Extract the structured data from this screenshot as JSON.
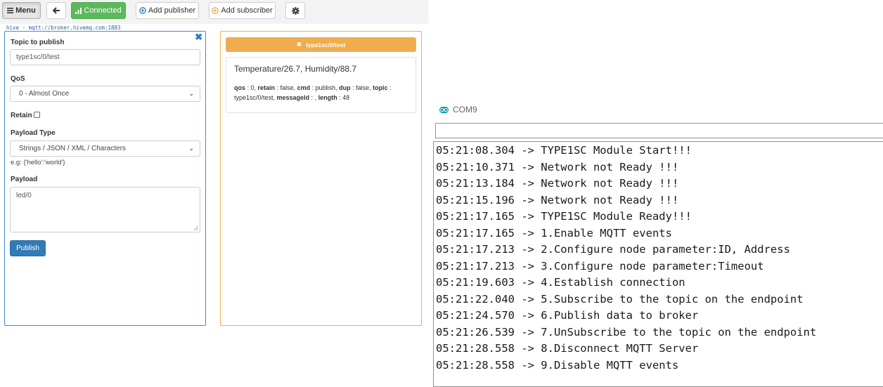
{
  "toolbar": {
    "menu_label": "Menu",
    "connected_label": "Connected",
    "add_publisher_label": "Add publisher",
    "add_subscriber_label": "Add subscriber"
  },
  "broker": {
    "label": "hive - mqtt://broker.hivemq.com:1883"
  },
  "publisher": {
    "topic_label": "Topic to publish",
    "topic_value": "type1sc/0/test",
    "qos_label": "QoS",
    "qos_value": "0 - Almost Once",
    "retain_label": "Retain",
    "retain_checked": false,
    "payload_type_label": "Payload Type",
    "payload_type_value": "Strings / JSON / XML / Characters",
    "payload_hint": "e.g: {'hello':'world'}",
    "payload_label": "Payload",
    "payload_value": "led/0",
    "publish_label": "Publish"
  },
  "subscriber": {
    "topic": "type1sc/0/test",
    "message": {
      "payload": "Temperature/26.7, Humidity/88.7",
      "qos_key": "qos",
      "qos_val": " : 0, ",
      "retain_key": "retain",
      "retain_val": " : false, ",
      "cmd_key": "cmd",
      "cmd_val": " : publish, ",
      "dup_key": "dup",
      "dup_val": " : false, ",
      "topic_key": "topic",
      "topic_val": " : type1sc/0/test, ",
      "messageid_key": "messageId",
      "messageid_val": " : , ",
      "length_key": "length",
      "length_val": " : 48"
    }
  },
  "serial_monitor": {
    "title": "COM9",
    "input_value": "",
    "lines": [
      "05:21:08.304 -> TYPE1SC Module Start!!!",
      "05:21:10.371 -> Network not Ready !!!",
      "05:21:13.184 -> Network not Ready !!!",
      "05:21:15.196 -> Network not Ready !!!",
      "05:21:17.165 -> TYPE1SC Module Ready!!!",
      "05:21:17.165 -> 1.Enable MQTT events",
      "05:21:17.213 -> 2.Configure node parameter:ID, Address",
      "05:21:17.213 -> 3.Configure node parameter:Timeout",
      "05:21:19.603 -> 4.Establish connection",
      "05:21:22.040 -> 5.Subscribe to the topic on the endpoint",
      "05:21:24.570 -> 6.Publish data to broker",
      "05:21:26.539 -> 7.UnSubscribe to the topic on the endpoint",
      "05:21:28.558 -> 8.Disconnect MQTT Server",
      "05:21:28.558 -> 9.Disable MQTT events"
    ]
  },
  "icons": {
    "menu": "hamburger-icon",
    "back": "arrow-left-icon",
    "signal": "signal-bars-icon",
    "add_pub": "plus-circle-icon",
    "add_sub": "plus-circle-icon",
    "settings": "gear-icon",
    "close_publisher": "close-icon",
    "close_subscriber": "close-icon",
    "arduino": "arduino-logo-icon"
  },
  "colors": {
    "connected": "#5cb85c",
    "publish": "#337ab7",
    "publisher_border": "#3a8fd6",
    "subscriber": "#f0ad4e",
    "add_subscriber_icon": "#f0ad4e",
    "arduino": "#00979c"
  }
}
